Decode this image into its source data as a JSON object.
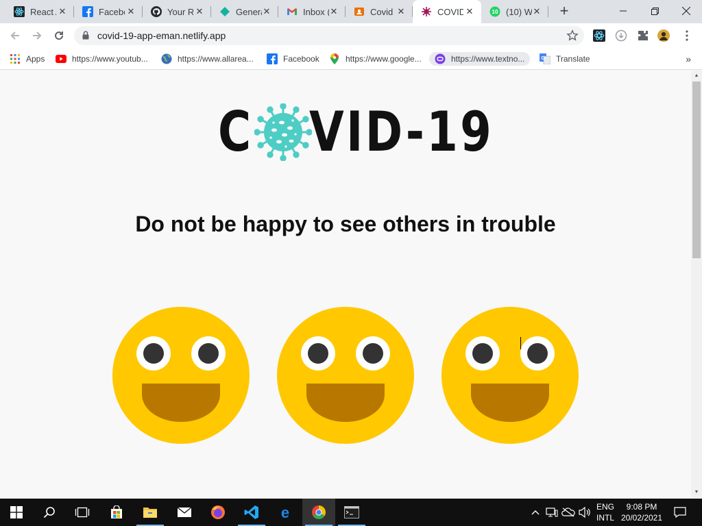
{
  "browser": {
    "tabs": [
      {
        "title": "React A",
        "icon": "react-icon"
      },
      {
        "title": "Facebo",
        "icon": "facebook-icon"
      },
      {
        "title": "Your R",
        "icon": "github-icon"
      },
      {
        "title": "Genera",
        "icon": "diamond-icon"
      },
      {
        "title": "Inbox (",
        "icon": "gmail-icon"
      },
      {
        "title": "Covid",
        "icon": "contacts-icon"
      },
      {
        "title": "COVID",
        "icon": "virus-icon"
      },
      {
        "title": "(10) W",
        "icon": "whatsapp-icon",
        "badge": "10"
      }
    ],
    "active_tab": 6,
    "url": "covid-19-app-eman.netlify.app",
    "bookmarks": [
      {
        "label": "Apps",
        "icon": "apps-grid-icon"
      },
      {
        "label": "https://www.youtub...",
        "icon": "youtube-icon"
      },
      {
        "label": "https://www.allarea...",
        "icon": "globe-icon"
      },
      {
        "label": "Facebook",
        "icon": "facebook-icon"
      },
      {
        "label": "https://www.google...",
        "icon": "maps-pin-icon"
      },
      {
        "label": "https://www.textno...",
        "icon": "textnow-icon"
      },
      {
        "label": "Translate",
        "icon": "translate-icon"
      }
    ]
  },
  "page": {
    "logo_left": "C",
    "logo_right": "VID-19",
    "headline": "Do not be happy to see others in trouble",
    "smiley_count": 3,
    "colors": {
      "face": "#ffc800",
      "mouth": "#b87800",
      "eye_white": "#ffffff",
      "pupil": "#333333",
      "virus": "#4ecdc4",
      "text": "#111111"
    }
  },
  "taskbar": {
    "language_line1": "ENG",
    "language_line2": "INTL",
    "time": "9:08 PM",
    "date": "20/02/2021",
    "pinned": [
      "windows-start-icon",
      "search-icon",
      "task-view-icon",
      "store-icon",
      "file-explorer-icon",
      "mail-icon",
      "firefox-icon",
      "vscode-icon",
      "edge-icon",
      "chrome-icon",
      "terminal-icon"
    ]
  }
}
